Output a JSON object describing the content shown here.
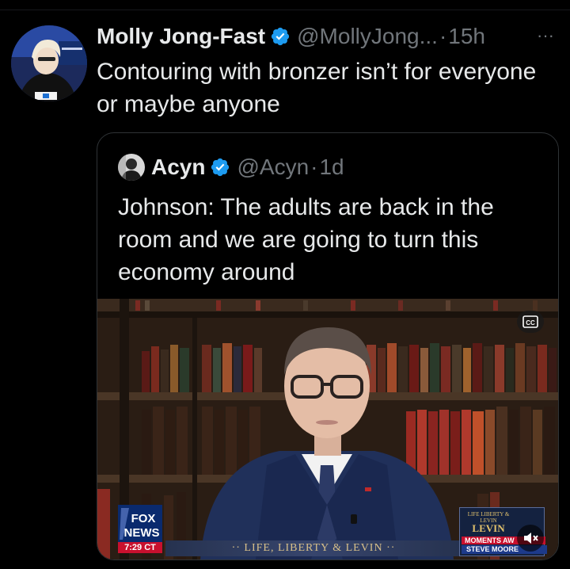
{
  "tweet": {
    "author_name": "Molly Jong-Fast",
    "handle": "@MollyJong...",
    "separator": "·",
    "time": "15h",
    "more_label": "···",
    "text": "Contouring with bronzer isn’t for everyone or maybe anyone"
  },
  "quoted": {
    "author_name": "Acyn",
    "handle": "@Acyn",
    "separator": "·",
    "time": "1d",
    "text": "Johnson: The adults are back in the room and we are going to turn this economy around"
  },
  "video": {
    "cc_label": "CC",
    "network_logo_line1": "FOX",
    "network_logo_line2": "NEWS",
    "clock": "7:29 CT",
    "lower_third": "·· LIFE, LIBERTY & LEVIN ··",
    "promo_logo": "LIFE LIBERTY & LEVIN",
    "promo_title": "LEVIN",
    "promo_moments": "MOMENTS AW",
    "promo_name": "STEVE MOORE"
  },
  "colors": {
    "background": "#000000",
    "text_primary": "#e7e9ea",
    "text_secondary": "#71767b",
    "verified_badge": "#1d9bf0",
    "border": "#2f3336"
  },
  "icons": {
    "verified": "verified-badge-icon",
    "more": "more-icon",
    "cc": "closed-captions-icon",
    "mute": "mute-icon"
  }
}
